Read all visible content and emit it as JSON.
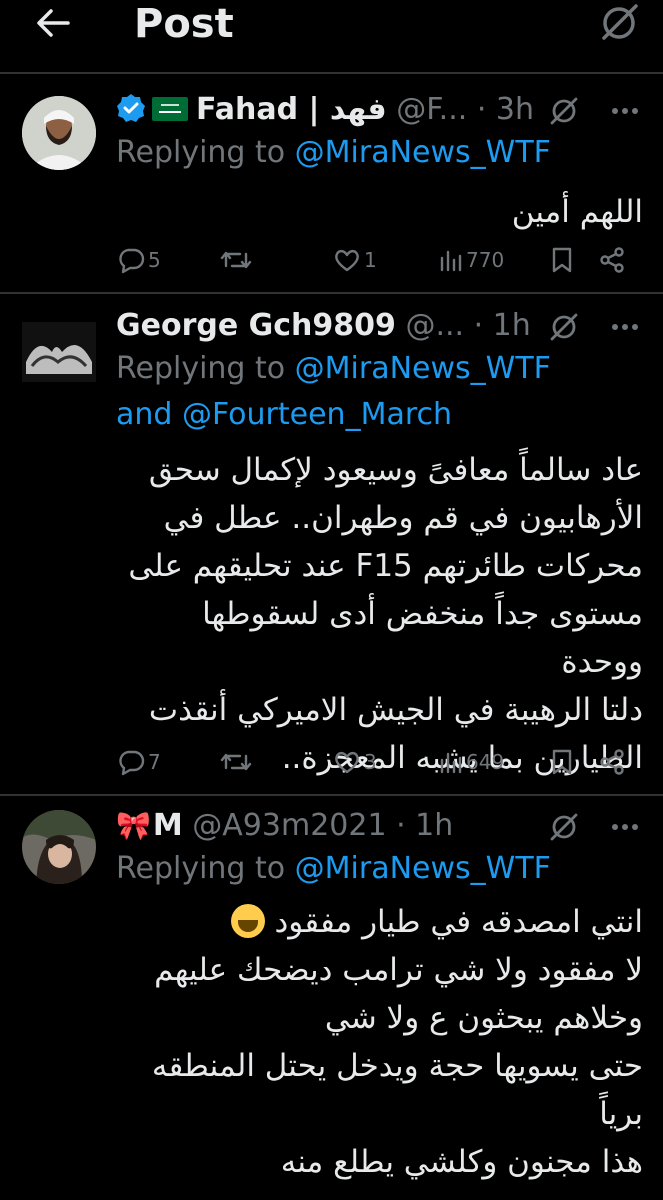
{
  "header": {
    "title": "Post"
  },
  "tweets": [
    {
      "name": "Fahad | فهد",
      "handle": "@F...",
      "time": "· 3h",
      "replying_prefix": "Replying to ",
      "replying_to": "@MiraNews_WTF",
      "and_text": "",
      "replying_to_2": "",
      "body": "اللهم أمين",
      "replies": "5",
      "retweets": "",
      "likes": "1",
      "views": "770"
    },
    {
      "name": "George Gch9809",
      "handle": "@...",
      "time": "· 1h",
      "replying_prefix": "Replying to ",
      "replying_to": "@MiraNews_WTF",
      "and_text": "and ",
      "replying_to_2": "@Fourteen_March",
      "body": "عاد سالماً معافىً وسيعود لإكمال سحق\nالأرهابيون في قم وطهران.. عطل في\nمحركات طائرتهم F15 عند تحليقهم  على\nمستوى جداً منخفض أدى لسقوطها ووحدة\nدلتا الرهيبة في الجيش الاميركي أنقذت\nالطيارين بما يشبه المعجزة..",
      "replies": "7",
      "retweets": "",
      "likes": "3",
      "views": "649"
    },
    {
      "name": "M",
      "handle": "@A93m2021",
      "time": "· 1h",
      "replying_prefix": "Replying to ",
      "replying_to": "@MiraNews_WTF",
      "and_text": "",
      "replying_to_2": "",
      "body_line1": "انتي امصدقه في طيار مفقود",
      "body": "لا مفقود ولا شي ترامب ديضحك عليهم\nوخلاهم يبحثون ع ولا شي\nحتى يسويها حجة ويدخل يحتل المنطقه\nبرياً\nهذا مجنون وكلشي يطلع منه"
    }
  ],
  "colors": {
    "accent": "#1d9bf0",
    "muted": "#71767b",
    "text": "#e7e9ea",
    "divider": "#2f3336"
  },
  "icons": [
    "back-arrow-icon",
    "grok-icon",
    "verified-badge-icon",
    "saudi-flag-icon",
    "bow-icon",
    "more-icon",
    "reply-icon",
    "retweet-icon",
    "like-icon",
    "views-icon",
    "bookmark-icon",
    "share-icon",
    "laughing-emoji-icon"
  ]
}
